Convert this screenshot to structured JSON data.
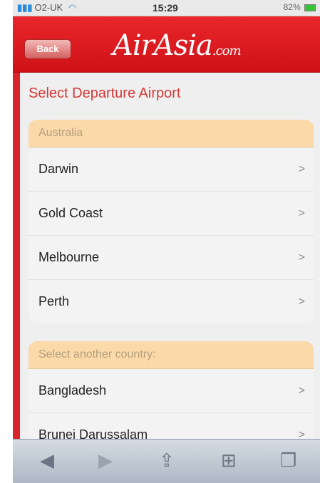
{
  "status": {
    "carrier": "O2-UK",
    "time": "15:29",
    "battery": "82%"
  },
  "header": {
    "back_label": "Back",
    "logo_text": "AirAsia",
    "logo_suffix": ".com"
  },
  "page": {
    "title": "Select Departure Airport"
  },
  "sections": [
    {
      "heading": "Australia",
      "items": [
        "Darwin",
        "Gold Coast",
        "Melbourne",
        "Perth"
      ]
    },
    {
      "heading": "Select another country:",
      "items": [
        "Bangladesh",
        "Brunei Darussalam"
      ]
    }
  ],
  "icons": {
    "chevron": "chevron-right-icon",
    "toolbar": [
      "back-arrow-icon",
      "forward-arrow-icon",
      "share-icon",
      "bookmarks-icon",
      "tabs-icon"
    ]
  },
  "colors": {
    "brand_red": "#d9151b",
    "section_header": "#fbd9a9",
    "title_red": "#d43a3a"
  }
}
